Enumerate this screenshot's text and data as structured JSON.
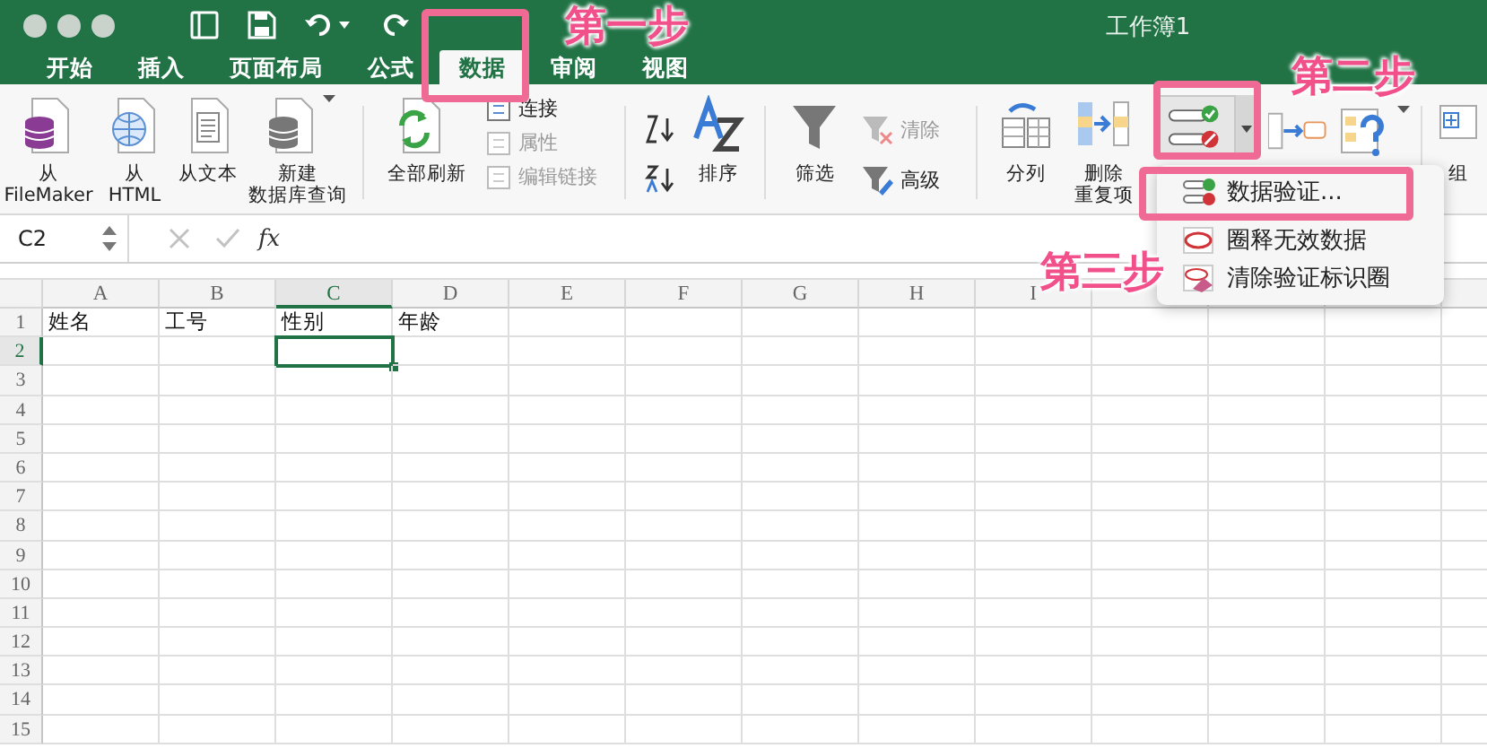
{
  "window": {
    "title": "工作簿1"
  },
  "tabs": [
    {
      "label": "开始",
      "selected": false
    },
    {
      "label": "插入",
      "selected": false
    },
    {
      "label": "页面布局",
      "selected": false
    },
    {
      "label": "公式",
      "selected": false
    },
    {
      "label": "数据",
      "selected": true
    },
    {
      "label": "审阅",
      "selected": false
    },
    {
      "label": "视图",
      "selected": false
    }
  ],
  "ribbon": {
    "get_data": [
      {
        "lines": [
          "从",
          "FileMaker"
        ]
      },
      {
        "lines": [
          "从",
          "HTML"
        ]
      },
      {
        "lines": [
          "从文本"
        ]
      },
      {
        "lines": [
          "新建",
          "数据库查询"
        ]
      }
    ],
    "refresh_all": "全部刷新",
    "connections": [
      {
        "label": "连接",
        "disabled": false
      },
      {
        "label": "属性",
        "disabled": true
      },
      {
        "label": "编辑链接",
        "disabled": true
      }
    ],
    "sort": "排序",
    "filter": "筛选",
    "filter_options": [
      {
        "label": "清除",
        "disabled": true
      },
      {
        "label": "高级",
        "disabled": false
      }
    ],
    "text_to_columns": "分列",
    "remove_duplicates": [
      "删除",
      "重复项"
    ],
    "group": "组"
  },
  "validation_menu": [
    {
      "label": "数据验证..."
    },
    {
      "label": "圈释无效数据"
    },
    {
      "label": "清除验证标识圈"
    }
  ],
  "formula_bar": {
    "name_box": "C2",
    "function_label": "fx"
  },
  "sheet": {
    "columns": [
      {
        "label": "A",
        "selected": false
      },
      {
        "label": "B",
        "selected": false
      },
      {
        "label": "C",
        "selected": true
      },
      {
        "label": "D",
        "selected": false
      },
      {
        "label": "E",
        "selected": false
      },
      {
        "label": "F",
        "selected": false
      },
      {
        "label": "G",
        "selected": false
      },
      {
        "label": "H",
        "selected": false
      },
      {
        "label": "I",
        "selected": false
      }
    ],
    "rows": [
      {
        "number": "1",
        "selected": false,
        "cells": [
          "姓名",
          "工号",
          "性别",
          "年龄"
        ]
      },
      {
        "number": "2",
        "selected": true
      },
      {
        "number": "3",
        "selected": false
      },
      {
        "number": "4",
        "selected": false
      },
      {
        "number": "5",
        "selected": false
      },
      {
        "number": "6",
        "selected": false
      },
      {
        "number": "7",
        "selected": false
      },
      {
        "number": "8",
        "selected": false
      },
      {
        "number": "9",
        "selected": false
      },
      {
        "number": "10",
        "selected": false
      },
      {
        "number": "11",
        "selected": false
      },
      {
        "number": "12",
        "selected": false
      },
      {
        "number": "13",
        "selected": false
      },
      {
        "number": "14",
        "selected": false
      },
      {
        "number": "15",
        "selected": false
      }
    ]
  },
  "annotations": [
    {
      "label": "第一步"
    },
    {
      "label": "第二步"
    },
    {
      "label": "第三步"
    }
  ]
}
